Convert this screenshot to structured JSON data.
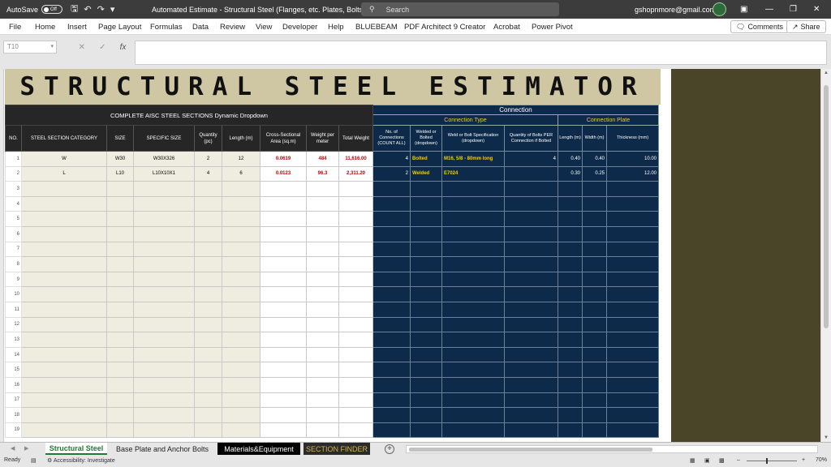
{
  "titlebar": {
    "autosave_label": "AutoSave",
    "autosave_state": "Off",
    "doc_title": "Automated Estimate - Structural Steel (Flanges, etc. Plates, Bolts)",
    "search_placeholder": "Search",
    "user_email": "gshopnmore@gmail.com"
  },
  "ribbon": {
    "tabs": [
      "File",
      "Home",
      "Insert",
      "Page Layout",
      "Formulas",
      "Data",
      "Review",
      "View",
      "Developer",
      "Help",
      "BLUEBEAM",
      "PDF Architect 9 Creator",
      "Acrobat",
      "Power Pivot"
    ],
    "comments_label": "Comments",
    "share_label": "Share"
  },
  "formula_bar": {
    "name_box": "T10",
    "fx_label": "fx",
    "formula": ""
  },
  "sheet": {
    "title": "STRUCTURAL STEEL ESTIMATOR",
    "left_header": "COMPLETE AISC STEEL SECTIONS Dynamic Dropdown",
    "connection_header": "Connection",
    "connection_type_header": "Connection Type",
    "connection_plate_header": "Connection Plate",
    "columns": {
      "no": "NO.",
      "category": "STEEL SECTION CATEGORY",
      "size": "SIZE",
      "specific": "SPECIFIC SIZE",
      "quantity": "Quantity (pc)",
      "length": "Length (m)",
      "area": "Cross-Sectional Area (sq.m)",
      "weight_per_meter": "Weight per meter",
      "total_weight": "Total Weight",
      "connections": "No. of Connections (COUNT ALL)",
      "welded": "Welded or Bolted (dropdown)",
      "spec": "Weld or Bolt Specification (dropdown)",
      "bolts_qty": "Quantity of Bolts PER Connection if Bolted",
      "plate_length": "Length (m)",
      "plate_width": "Width (m)",
      "plate_thickness": "Thickness (mm)"
    },
    "rows": [
      {
        "no": "1",
        "category": "W",
        "size": "W30",
        "specific": "W30X326",
        "quantity": "2",
        "length": "12",
        "area": "0.0619",
        "wpm": "484",
        "total": "11,616.00",
        "connections": "4",
        "type": "Bolted",
        "spec": "M16, 5/8 - 80mm long",
        "bolts": "4",
        "plen": "0.40",
        "pwid": "0.40",
        "pthk": "10.00"
      },
      {
        "no": "2",
        "category": "L",
        "size": "L10",
        "specific": "L10X10X1",
        "quantity": "4",
        "length": "6",
        "area": "0.0123",
        "wpm": "96.3",
        "total": "2,311.20",
        "connections": "2",
        "type": "Welded",
        "spec": "E7024",
        "bolts": "",
        "plen": "0.30",
        "pwid": "0.25",
        "pthk": "12.00"
      },
      {
        "no": "3"
      },
      {
        "no": "4"
      },
      {
        "no": "5"
      },
      {
        "no": "6"
      },
      {
        "no": "7"
      },
      {
        "no": "8"
      },
      {
        "no": "9"
      },
      {
        "no": "10"
      },
      {
        "no": "11"
      },
      {
        "no": "12"
      },
      {
        "no": "13"
      },
      {
        "no": "14"
      },
      {
        "no": "15"
      },
      {
        "no": "16"
      },
      {
        "no": "17"
      },
      {
        "no": "18"
      },
      {
        "no": "19"
      }
    ]
  },
  "sheet_tabs": {
    "tabs": [
      "Structural Steel",
      "Base Plate and Anchor Bolts",
      "Materials&Equipment",
      "SECTION FINDER"
    ],
    "active": "Structural Steel"
  },
  "statusbar": {
    "ready": "Ready",
    "accessibility": "Accessibility: Investigate",
    "zoom": "70%"
  }
}
